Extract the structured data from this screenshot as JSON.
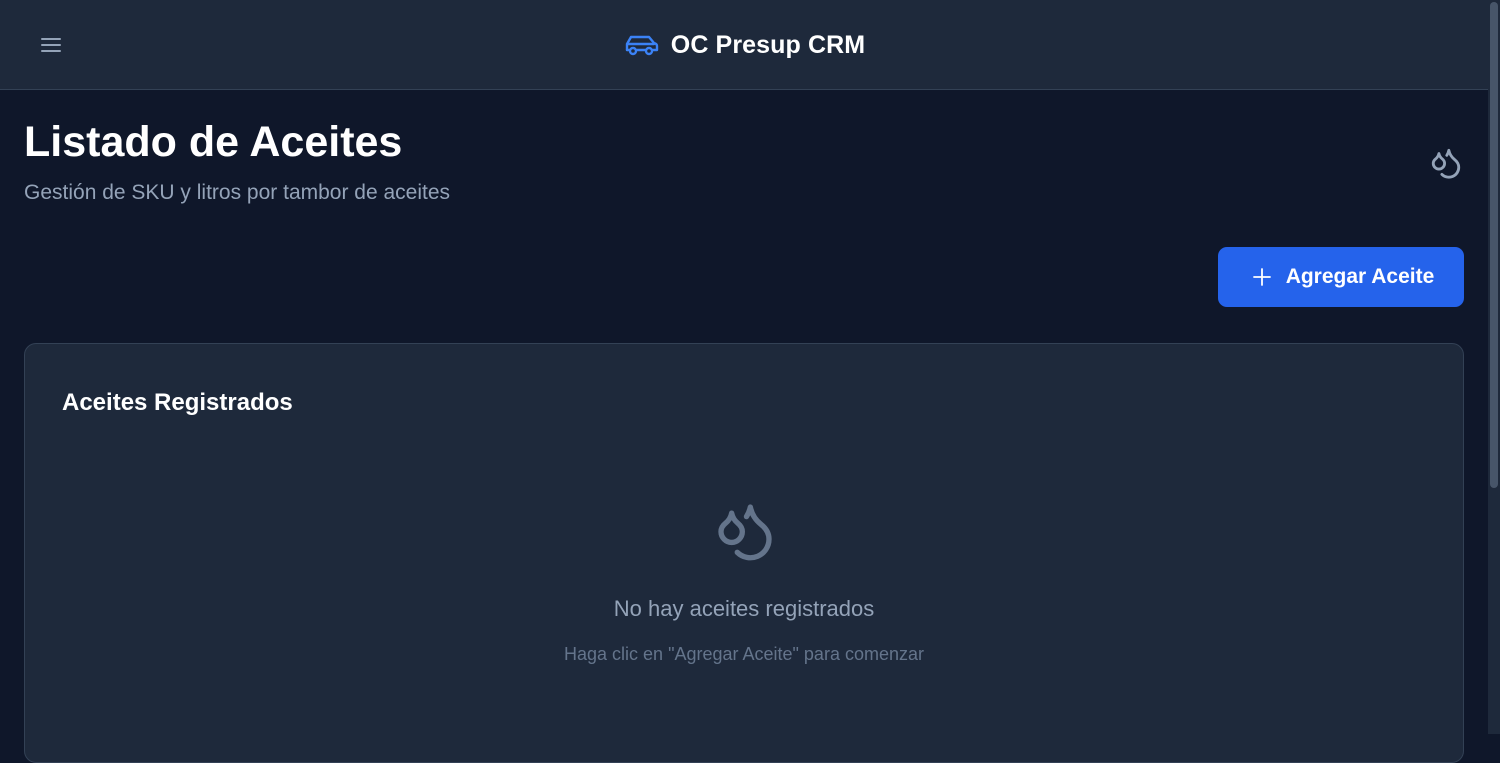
{
  "app": {
    "title": "OC Presup CRM",
    "menu_icon": "hamburger-menu-icon",
    "brand_icon": "car-icon",
    "brand_color": "#3b82f6"
  },
  "page": {
    "title": "Listado de Aceites",
    "subtitle": "Gestión de SKU y litros por tambor de aceites",
    "header_icon": "droplets-icon"
  },
  "actions": {
    "add_label": "Agregar Aceite",
    "add_icon": "plus-icon",
    "accent": "#2563eb"
  },
  "card": {
    "title": "Aceites Registrados",
    "empty_icon": "droplets-icon",
    "empty_title": "No hay aceites registrados",
    "empty_hint": "Haga clic en \"Agregar Aceite\" para comenzar"
  },
  "colors": {
    "background": "#0f172a",
    "surface": "#1e293b",
    "border": "#334155",
    "muted_text": "#94a3b8"
  }
}
